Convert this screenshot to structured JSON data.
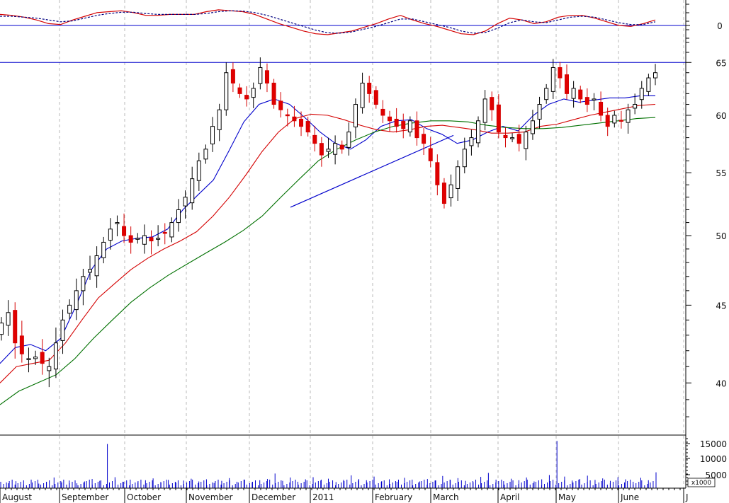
{
  "chart_data": {
    "type": "candlestick-with-indicators",
    "panels": {
      "oscillator": {
        "zero_label": "0",
        "series": [
          {
            "style": "solid",
            "color": "#d40000",
            "values": [
              0.6,
              0.55,
              0.45,
              0.3,
              0.1,
              0.05,
              0.3,
              0.5,
              0.7,
              0.75,
              0.8,
              0.7,
              0.55,
              0.55,
              0.6,
              0.6,
              0.6,
              0.75,
              0.85,
              0.8,
              0.75,
              0.6,
              0.35,
              0.1,
              -0.1,
              -0.3,
              -0.45,
              -0.5,
              -0.4,
              -0.3,
              -0.1,
              0.1,
              0.35,
              0.55,
              0.3,
              0.1,
              -0.05,
              -0.25,
              -0.45,
              -0.5,
              -0.3,
              0.1,
              0.4,
              0.3,
              0.1,
              0.2,
              0.45,
              0.55,
              0.55,
              0.4,
              0.2,
              0.0,
              -0.05,
              0.1,
              0.3
            ]
          },
          {
            "style": "dashed",
            "color": "#000080",
            "values": [
              0.5,
              0.5,
              0.45,
              0.4,
              0.3,
              0.2,
              0.25,
              0.4,
              0.55,
              0.65,
              0.72,
              0.72,
              0.65,
              0.6,
              0.6,
              0.6,
              0.6,
              0.65,
              0.75,
              0.8,
              0.78,
              0.7,
              0.55,
              0.35,
              0.15,
              -0.05,
              -0.25,
              -0.4,
              -0.42,
              -0.35,
              -0.2,
              -0.05,
              0.15,
              0.35,
              0.35,
              0.2,
              0.05,
              -0.1,
              -0.3,
              -0.42,
              -0.38,
              -0.15,
              0.15,
              0.3,
              0.2,
              0.15,
              0.3,
              0.45,
              0.5,
              0.45,
              0.3,
              0.15,
              0.05,
              0.05,
              0.2
            ]
          }
        ]
      },
      "price": {
        "y_ticks": [
          40,
          45,
          50,
          55,
          60,
          65
        ],
        "ylim": [
          37,
          67
        ],
        "log_scale": true,
        "horizontal_line": 65,
        "moving_averages": [
          {
            "color": "#0000cc",
            "values": [
              41.2,
              42.2,
              42.4,
              42.0,
              42.8,
              45.0,
              47.5,
              49.0,
              49.6,
              49.8,
              49.9,
              50.5,
              52.0,
              53.2,
              54.4,
              56.8,
              59.4,
              61.0,
              61.5,
              61.0,
              59.8,
              58.5,
              57.5,
              57.0,
              57.8,
              59.0,
              59.5,
              59.6,
              58.8,
              58.3,
              57.5,
              57.8,
              58.5,
              59.0,
              58.6,
              60.0,
              61.0,
              61.5,
              61.2,
              61.4,
              61.6,
              61.6,
              61.8,
              61.8
            ]
          },
          {
            "color": "#d40000",
            "values": [
              40.0,
              41.0,
              41.2,
              41.4,
              42.5,
              44.0,
              45.5,
              46.5,
              47.5,
              48.3,
              49.0,
              49.6,
              50.3,
              51.5,
              53.0,
              54.8,
              56.8,
              58.5,
              59.7,
              60.1,
              60.0,
              59.6,
              59.1,
              58.7,
              58.5,
              58.7,
              59.0,
              59.1,
              58.9,
              58.7,
              58.4,
              58.4,
              58.5,
              59.0,
              59.2,
              59.6,
              60.0,
              60.3,
              60.6,
              60.9,
              61.0
            ]
          },
          {
            "color": "#007000",
            "values": [
              38.7,
              39.5,
              40.0,
              40.5,
              41.5,
              42.8,
              44.0,
              45.2,
              46.2,
              47.1,
              47.9,
              48.7,
              49.5,
              50.4,
              51.5,
              53.0,
              54.5,
              56.0,
              57.0,
              57.8,
              58.5,
              59.0,
              59.3,
              59.5,
              59.5,
              59.4,
              59.1,
              58.9,
              58.8,
              58.8,
              58.9,
              59.1,
              59.3,
              59.5,
              59.7,
              59.8
            ]
          }
        ],
        "trendline": {
          "from": [
            0.41,
            52.2
          ],
          "to": [
            0.64,
            58.2
          ],
          "color": "#0000cc"
        },
        "candles_close": [
          43.8,
          44.5,
          42.5,
          41.8,
          41.5,
          41.6,
          41.2,
          41.0,
          42.5,
          44.0,
          45.0,
          46.0,
          47.0,
          47.5,
          48.5,
          49.5,
          50.5,
          51.0,
          50.0,
          49.5,
          49.8,
          50.0,
          49.6,
          49.8,
          50.2,
          51.0,
          52.0,
          53.0,
          54.5,
          56.0,
          57.0,
          59.0,
          60.5,
          64.0,
          63.0,
          62.0,
          61.5,
          62.5,
          64.5,
          63.0,
          61.0,
          60.5,
          60.0,
          59.5,
          59.0,
          58.5,
          57.5,
          56.5,
          57.0,
          57.5,
          57.0,
          58.5,
          61.0,
          63.0,
          62.0,
          61.0,
          60.0,
          59.5,
          59.0,
          58.8,
          59.5,
          58.0,
          57.5,
          56.0,
          54.0,
          52.5,
          54.0,
          55.5,
          57.0,
          58.0,
          59.5,
          61.5,
          60.5,
          58.5,
          58.0,
          58.0,
          57.5,
          58.5,
          59.5,
          61.0,
          62.5,
          64.5,
          63.5,
          62.0,
          62.5,
          61.5,
          61.0,
          61.5,
          60.0,
          59.0,
          60.0,
          59.5,
          60.5,
          61.0,
          62.5,
          63.5,
          64.0
        ]
      },
      "volume": {
        "y_ticks": [
          "15000",
          "10000",
          "5000"
        ],
        "multiplier_label": "x1000",
        "values": [
          2.1,
          1.6,
          2.3,
          1.2,
          2.8,
          1.5,
          2.0,
          3.5,
          1.9,
          2.5,
          1.6,
          2.2,
          3.0,
          2.4,
          14.5,
          3.6,
          2.1,
          2.8,
          1.9,
          2.6,
          3.2,
          2.0,
          2.7,
          1.8,
          2.5,
          3.1,
          2.2,
          2.9,
          1.7,
          2.4,
          3.3,
          2.1,
          2.8,
          1.9,
          2.6,
          3.0,
          4.8,
          2.4,
          3.5,
          2.1,
          2.9,
          3.6,
          2.5,
          3.1,
          2.0,
          2.7,
          4.2,
          3.0,
          2.6,
          3.8,
          2.3,
          2.9,
          2.1,
          3.4,
          2.8,
          2.2,
          3.0,
          2.5,
          4.0,
          2.7,
          3.3,
          2.4,
          2.0,
          3.7,
          5.0,
          2.8,
          2.3,
          3.1,
          2.6,
          3.5,
          2.2,
          2.9,
          4.3,
          15.5,
          3.8,
          2.5,
          3.0,
          4.1,
          2.7,
          3.2,
          2.4,
          3.6,
          2.9,
          2.1,
          3.4,
          2.6,
          5.2
        ]
      }
    },
    "x_labels": [
      "August",
      "September",
      "October",
      "November",
      "December",
      "2011",
      "February",
      "March",
      "April",
      "May",
      "June",
      "J"
    ]
  }
}
